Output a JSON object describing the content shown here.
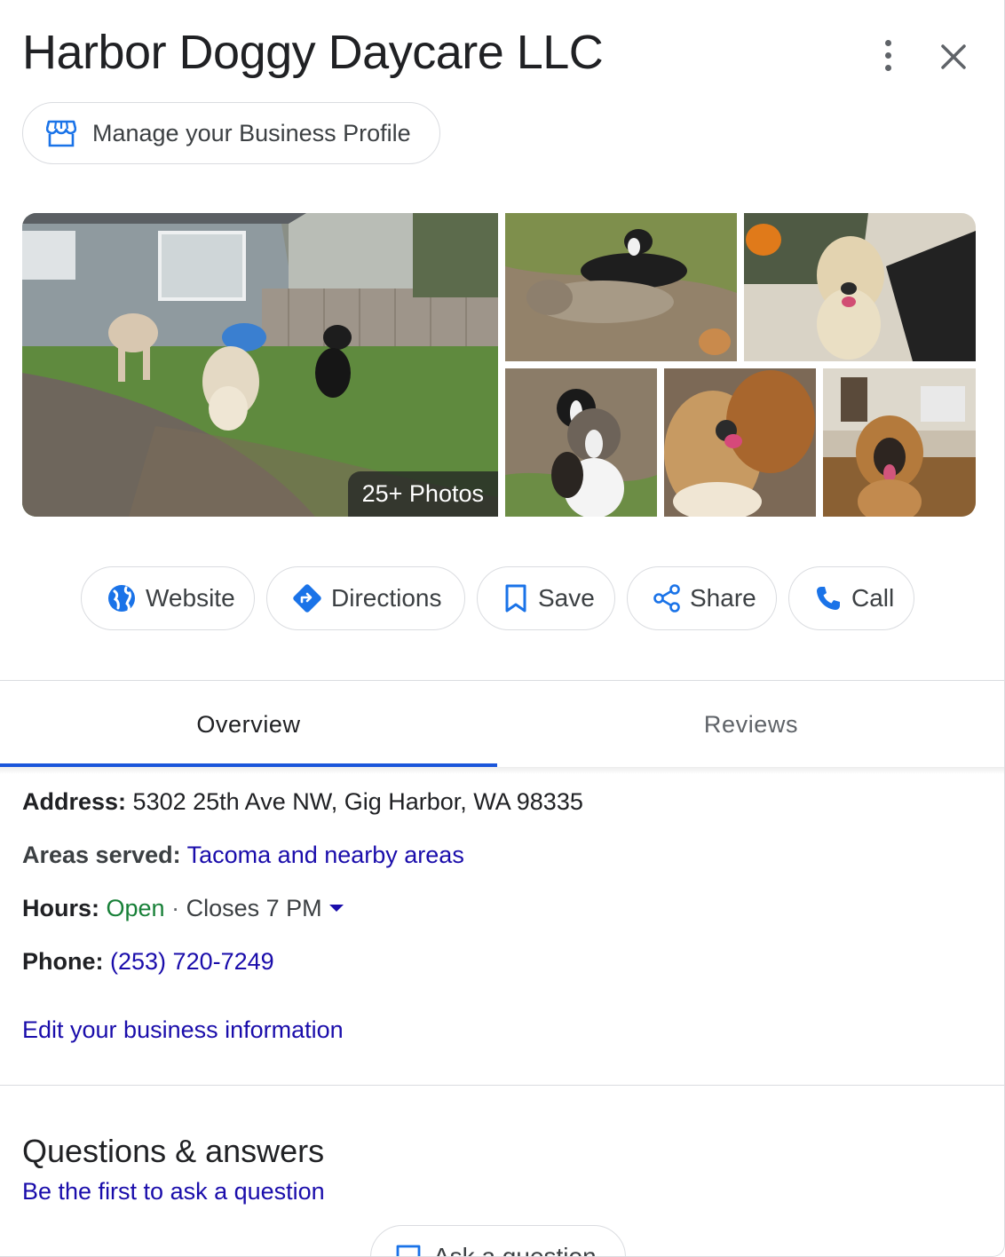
{
  "business": {
    "name": "Harbor Doggy Daycare LLC",
    "manage_profile_label": "Manage your Business Profile"
  },
  "photos": {
    "count_label": "25+ Photos"
  },
  "actions": {
    "website": "Website",
    "directions": "Directions",
    "save": "Save",
    "share": "Share",
    "call": "Call"
  },
  "tabs": [
    {
      "label": "Overview",
      "active": true
    },
    {
      "label": "Reviews",
      "active": false
    }
  ],
  "details": {
    "address_label": "Address:",
    "address_value": "5302 25th Ave NW, Gig Harbor, WA 98335",
    "areas_label": "Areas served:",
    "areas_value": "Tacoma and nearby areas",
    "hours_label": "Hours:",
    "hours_status": "Open",
    "hours_sep": "·",
    "hours_closes": "Closes 7 PM",
    "phone_label": "Phone:",
    "phone_value": "(253) 720-7249",
    "edit_link": "Edit your business information"
  },
  "qa": {
    "title": "Questions & answers",
    "first_link": "Be the first to ask a question",
    "ask_button": "Ask a question"
  },
  "colors": {
    "link": "#1a0dab",
    "open": "#188038",
    "accent_blue": "#1a73e8",
    "tab_underline": "#1a56db"
  }
}
